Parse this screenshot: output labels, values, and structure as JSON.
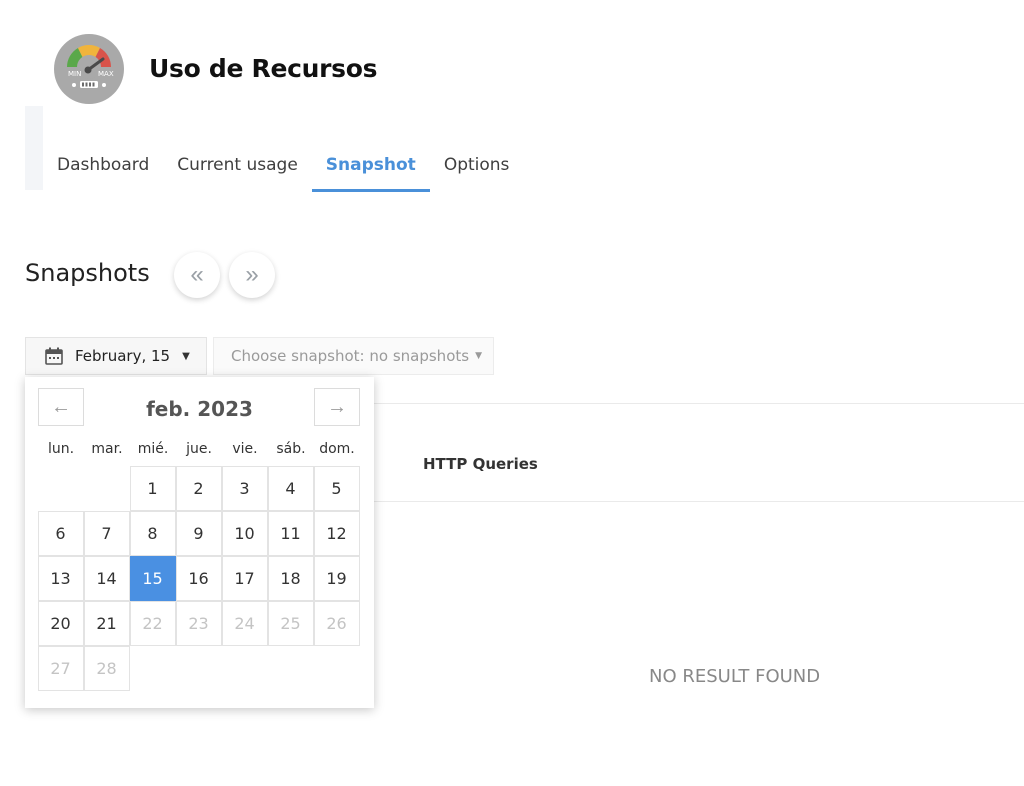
{
  "app": {
    "title": "Uso de Recursos",
    "logo_min": "MIN",
    "logo_max": "MAX"
  },
  "tabs": [
    {
      "label": "Dashboard",
      "active": false
    },
    {
      "label": "Current usage",
      "active": false
    },
    {
      "label": "Snapshot",
      "active": true
    },
    {
      "label": "Options",
      "active": false
    }
  ],
  "section": {
    "title": "Snapshots",
    "prev_icon": "double-chevron-left-icon",
    "next_icon": "double-chevron-right-icon"
  },
  "controls": {
    "date_label": "February, 15",
    "snapshot_select_label": "Choose snapshot: no snapshots"
  },
  "calendar": {
    "month_label": "feb. 2023",
    "weekdays": [
      "lun.",
      "mar.",
      "mié.",
      "jue.",
      "vie.",
      "sáb.",
      "dom."
    ],
    "selected_day": 15,
    "rows": [
      [
        "",
        "",
        "1",
        "2",
        "3",
        "4",
        "5"
      ],
      [
        "6",
        "7",
        "8",
        "9",
        "10",
        "11",
        "12"
      ],
      [
        "13",
        "14",
        "15",
        "16",
        "17",
        "18",
        "19"
      ],
      [
        "20",
        "21",
        "22",
        "23",
        "24",
        "25",
        "26"
      ],
      [
        "27",
        "28",
        "",
        "",
        "",
        "",
        ""
      ]
    ],
    "disabled_from": 22
  },
  "table": {
    "column_http": "HTTP Queries",
    "empty_message": "NO RESULT FOUND"
  },
  "colors": {
    "accent": "#4a90d9",
    "selected_day": "#4a90e2"
  }
}
